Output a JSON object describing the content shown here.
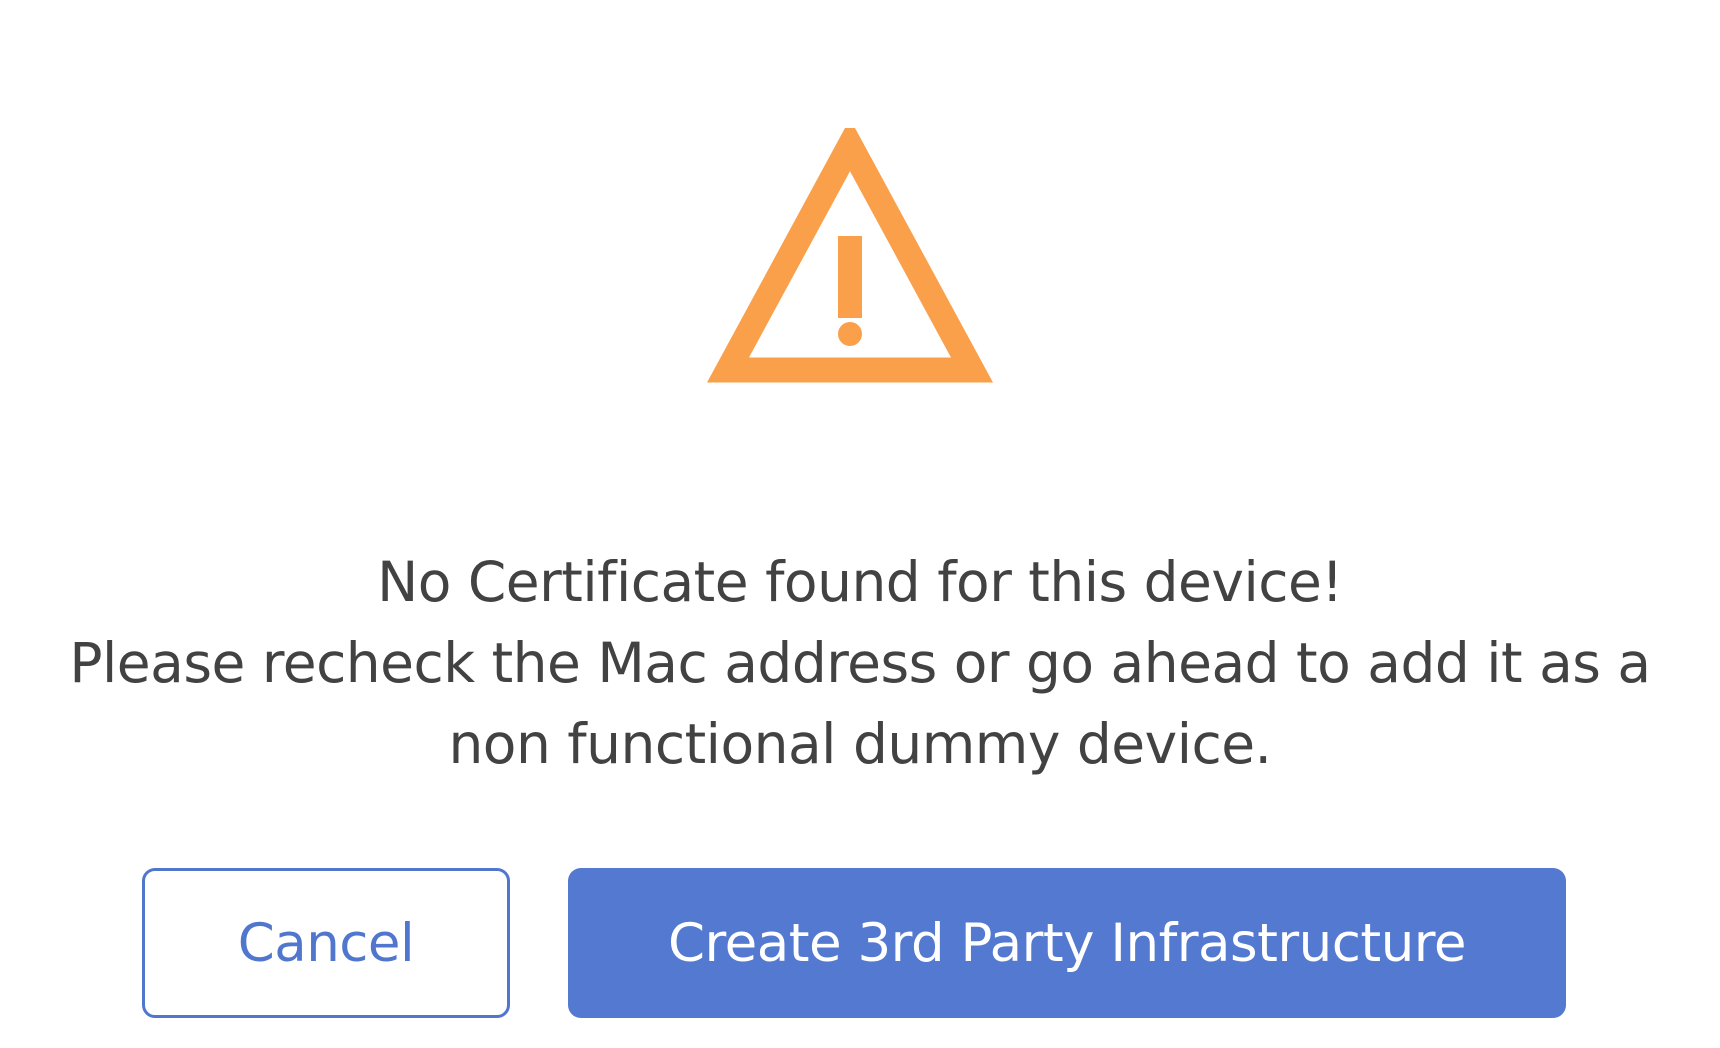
{
  "dialog": {
    "icon": "warning-triangle-icon",
    "icon_color": "#fba04a",
    "message_lines": [
      "No Certificate found for this device!",
      "Please recheck the Mac address or go ahead to add it as a",
      "non functional dummy device."
    ],
    "buttons": {
      "cancel_label": "Cancel",
      "create_label": "Create 3rd Party Infrastructure"
    },
    "colors": {
      "primary": "#5479d0",
      "text": "#424242",
      "background": "#ffffff"
    }
  }
}
